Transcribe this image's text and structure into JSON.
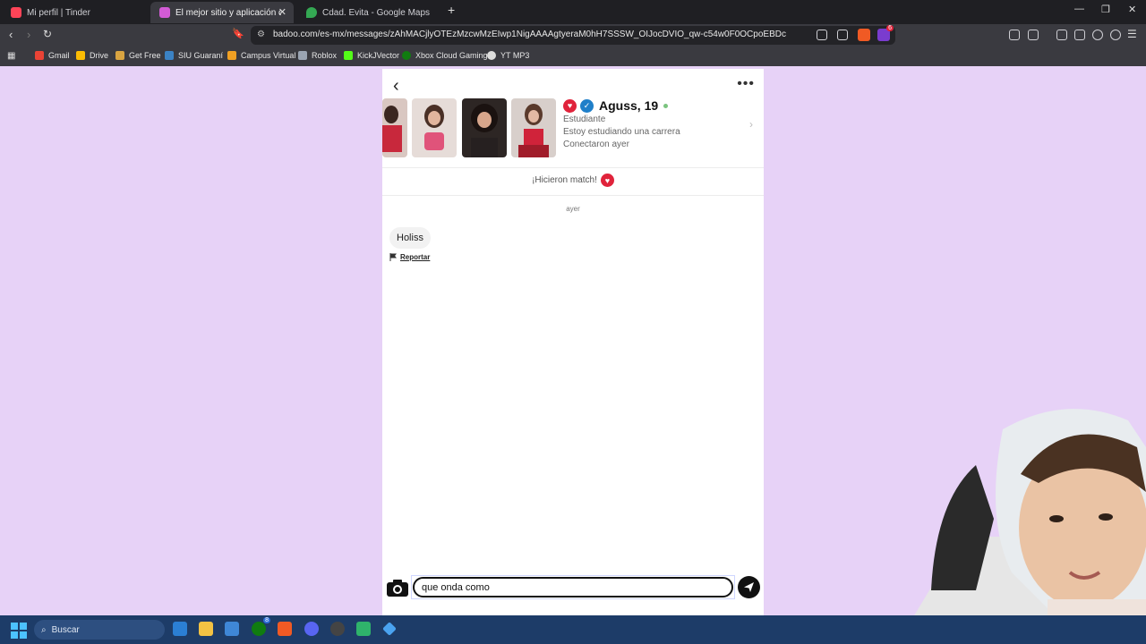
{
  "browser": {
    "tabs": [
      {
        "title": "Mi perfil | Tinder",
        "active": false,
        "color": "#ff4458"
      },
      {
        "title": "El mejor sitio y aplicación de cita",
        "active": true,
        "color": "#d35bd6"
      },
      {
        "title": "Cdad. Evita - Google Maps",
        "active": false,
        "color": "#34a853"
      }
    ],
    "new_tab": "+",
    "url": "badoo.com/es-mx/messages/zAhMACjlyOTEzMzcwMzEIwp1NigAAAAgtyeraM0hH7SSSW_OIJocDVIO_qw-c54w0F0OCpoEBDc",
    "bookmarks": [
      "Gmail",
      "Drive",
      "Get Free",
      "SIU Guaraní",
      "Campus Virtual",
      "Roblox",
      "KickJVector",
      "Xbox Cloud Gaming",
      "YT MP3"
    ],
    "extension_badge": "6"
  },
  "profile": {
    "name": "Aguss, 19",
    "occupation": "Estudiante",
    "education": "Estoy estudiando una carrera",
    "last_seen": "Conectaron ayer",
    "online_color": "#7bc47f"
  },
  "chat": {
    "match_text": "¡Hicieron match!",
    "date_label": "ayer",
    "messages": [
      {
        "text": "Holiss",
        "report_label": "Reportar"
      }
    ],
    "input_value": "que onda como "
  },
  "taskbar": {
    "search_label": "Buscar",
    "xbox_badge": "8"
  },
  "colors": {
    "page_bg": "#e7d2f7",
    "accent": "#e0233b",
    "verified": "#1f7fc9"
  }
}
